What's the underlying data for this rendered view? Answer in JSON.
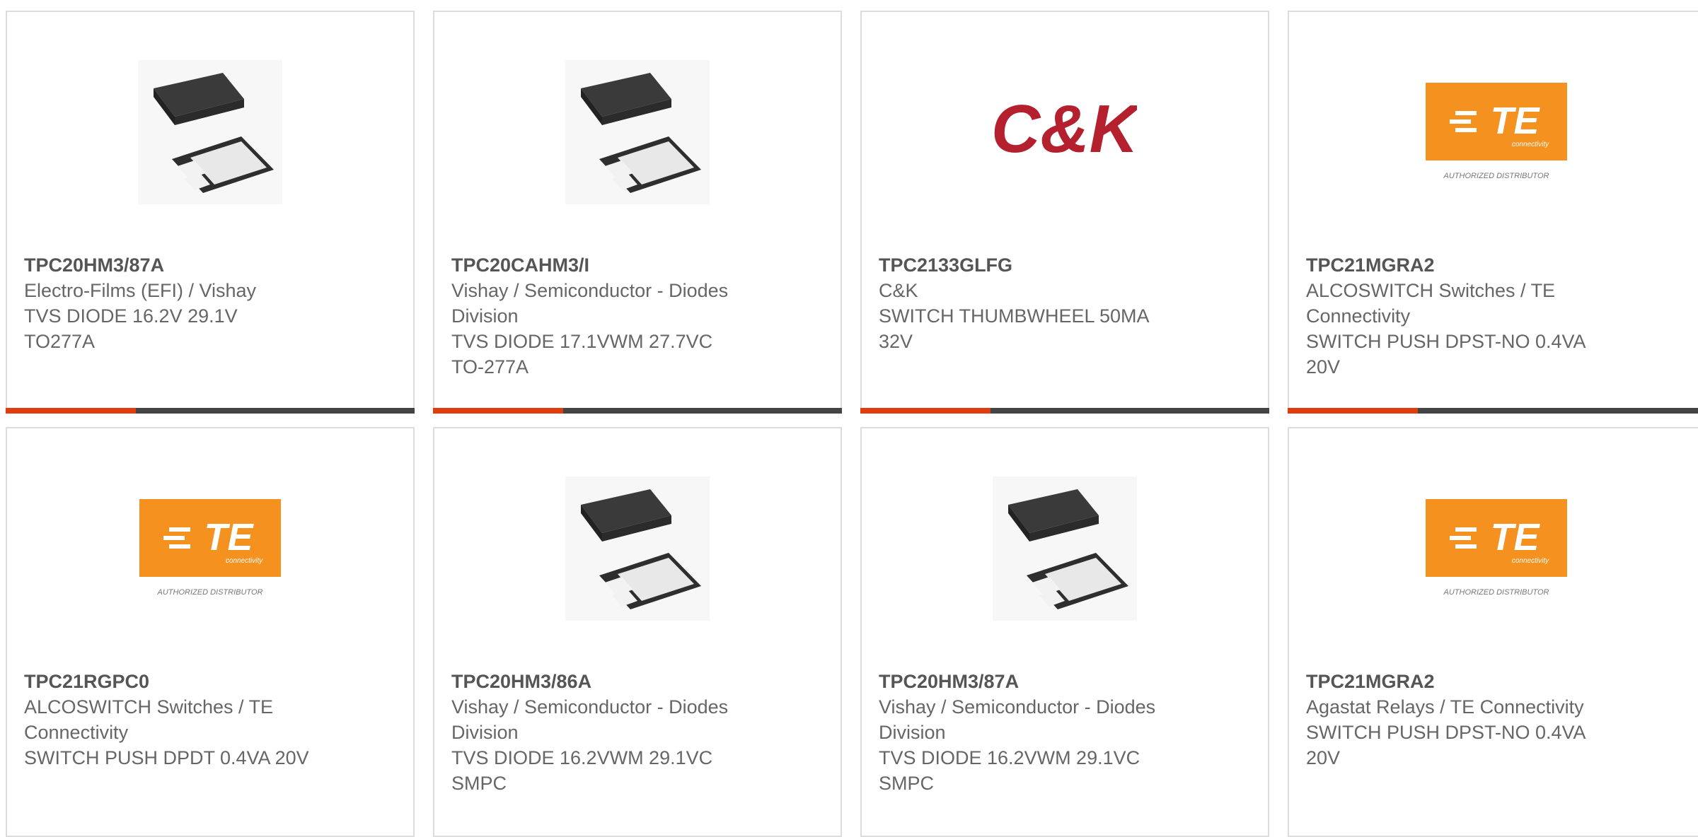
{
  "colors": {
    "accent": "#e03c0f",
    "bar": "#444444",
    "te_orange": "#f5911f",
    "ck_red": "#b5202e"
  },
  "cards": [
    {
      "image": "diode-package-image",
      "part_number": "TPC20HM3/87A",
      "manufacturer": "Electro-Films (EFI) / Vishay",
      "description": "TVS DIODE 16.2V 29.1V",
      "package": "TO277A"
    },
    {
      "image": "diode-package-image",
      "part_number": "TPC20CAHM3/I",
      "manufacturer": "Vishay / Semiconductor - Diodes",
      "manufacturer_2": "Division",
      "description": "TVS DIODE 17.1VWM 27.7VC",
      "package": "TO-277A"
    },
    {
      "image": "ck-logo",
      "logo_text": "C&K",
      "part_number": "TPC2133GLFG",
      "manufacturer": "C&K",
      "description": "SWITCH THUMBWHEEL 50MA",
      "package": "32V"
    },
    {
      "image": "te-connectivity-logo",
      "logo_text": "TE",
      "logo_sub": "connectivity",
      "logo_caption": "AUTHORIZED DISTRIBUTOR",
      "part_number": "TPC21MGRA2",
      "manufacturer": "ALCOSWITCH Switches / TE",
      "manufacturer_2": "Connectivity",
      "description": "SWITCH PUSH DPST-NO 0.4VA",
      "package": "20V"
    },
    {
      "image": "te-connectivity-logo",
      "logo_text": "TE",
      "logo_sub": "connectivity",
      "logo_caption": "AUTHORIZED DISTRIBUTOR",
      "part_number": "TPC21RGPC0",
      "manufacturer": "ALCOSWITCH Switches / TE",
      "manufacturer_2": "Connectivity",
      "description": "SWITCH PUSH DPDT 0.4VA 20V"
    },
    {
      "image": "diode-package-image",
      "part_number": "TPC20HM3/86A",
      "manufacturer": "Vishay / Semiconductor - Diodes",
      "manufacturer_2": "Division",
      "description": "TVS DIODE 16.2VWM 29.1VC",
      "package": "SMPC"
    },
    {
      "image": "diode-package-image",
      "part_number": "TPC20HM3/87A",
      "manufacturer": "Vishay / Semiconductor - Diodes",
      "manufacturer_2": "Division",
      "description": "TVS DIODE 16.2VWM 29.1VC",
      "package": "SMPC"
    },
    {
      "image": "te-connectivity-logo",
      "logo_text": "TE",
      "logo_sub": "connectivity",
      "logo_caption": "AUTHORIZED DISTRIBUTOR",
      "part_number": "TPC21MGRA2",
      "manufacturer": "Agastat Relays / TE Connectivity",
      "description": "SWITCH PUSH DPST-NO 0.4VA",
      "package": "20V"
    }
  ]
}
